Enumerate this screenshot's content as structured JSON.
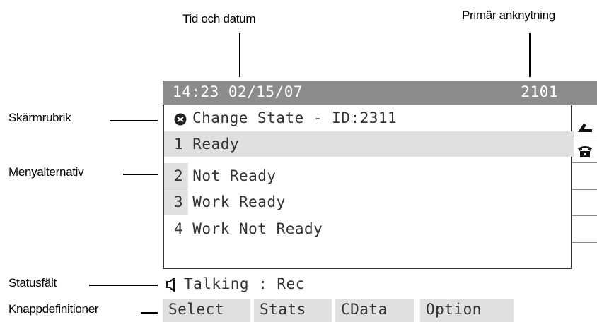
{
  "callouts": {
    "time_date": "Tid och datum",
    "primary_ext": "Primär anknytning",
    "screen_title": "Skärmrubrik",
    "menu_options": "Menyalternativ",
    "status_field": "Statusfält",
    "key_definitions": "Knappdefinitioner"
  },
  "header": {
    "time_date": "14:23 02/15/07",
    "extension": "2101"
  },
  "screen": {
    "title": "Change State - ID:2311",
    "title_icon": "state-icon"
  },
  "menu": {
    "items": [
      {
        "label": "1 Ready"
      },
      {
        "label": "2 Not Ready"
      },
      {
        "label": "3 Work Ready"
      },
      {
        "label": "4 Work Not Ready"
      }
    ]
  },
  "status": {
    "text": "Talking : Rec",
    "icon": "speaker-icon"
  },
  "softkeys": [
    "Select",
    "Stats",
    "CData",
    "Option"
  ],
  "line_icons": [
    "handset-offhook-icon",
    "phone-icon"
  ],
  "colors": {
    "header_bg": "#8c8c8c",
    "highlight_bg": "#e0e0e0"
  }
}
